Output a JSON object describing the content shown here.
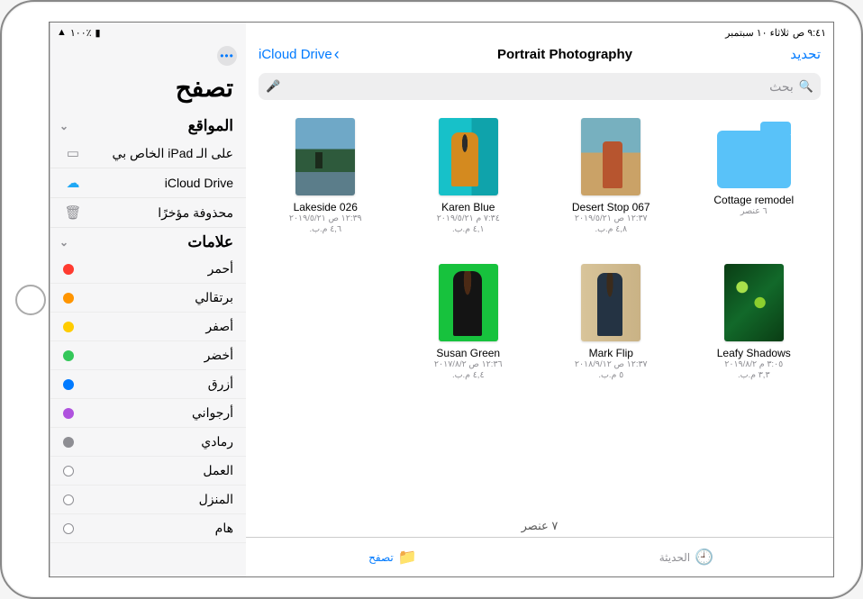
{
  "status": {
    "time": "٩:٤١ ص",
    "date": "ثلاثاء ١٠ سبتمبر",
    "battery": "٪١٠٠"
  },
  "sidebar": {
    "browse": "تصفح",
    "locations_header": "المواقع",
    "locations": [
      {
        "label": "على الـ iPad الخاص بي",
        "icon": "ipad"
      },
      {
        "label": "iCloud Drive",
        "icon": "cloud"
      },
      {
        "label": "محذوفة مؤخرًا",
        "icon": "trash"
      }
    ],
    "tags_header": "علامات",
    "tags": [
      {
        "label": "أحمر",
        "color": "#ff3b30"
      },
      {
        "label": "برتقالي",
        "color": "#ff9500"
      },
      {
        "label": "أصفر",
        "color": "#ffcc00"
      },
      {
        "label": "أخضر",
        "color": "#34c759"
      },
      {
        "label": "أزرق",
        "color": "#007aff"
      },
      {
        "label": "أرجواني",
        "color": "#af52de"
      },
      {
        "label": "رمادي",
        "color": "#8e8e93"
      },
      {
        "label": "العمل",
        "hollow": true
      },
      {
        "label": "المنزل",
        "hollow": true
      },
      {
        "label": "هام",
        "hollow": true
      }
    ]
  },
  "nav": {
    "back": "iCloud Drive",
    "title": "Portrait Photography",
    "select": "تحديد",
    "search_placeholder": "بحث"
  },
  "items": [
    {
      "type": "folder",
      "name": "Cottage remodel",
      "meta1": "٦ عنصر",
      "meta2": ""
    },
    {
      "type": "photo",
      "name": "Desert Stop 067",
      "meta1": "١٢:٣٧ ص ٢٠١٩/٥/٢١",
      "meta2": "٤,٨ م.ب.",
      "thumb": "th-desert"
    },
    {
      "type": "photo",
      "name": "Karen Blue",
      "meta1": "٧:٣٤ م ٢٠١٩/٥/٢١",
      "meta2": "٤,١ م.ب.",
      "thumb": "th-karen"
    },
    {
      "type": "photo",
      "name": "Lakeside 026",
      "meta1": "١٢:٣٩ ص ٢٠١٩/٥/٢١",
      "meta2": "٤,٦ م.ب.",
      "thumb": "th-lake"
    },
    {
      "type": "photo",
      "name": "Leafy Shadows",
      "meta1": "٣:٠٥ م ٢٠١٩/٨/٢",
      "meta2": "٣,٣ م.ب.",
      "thumb": "th-leaf"
    },
    {
      "type": "photo",
      "name": "Mark Flip",
      "meta1": "١٢:٣٧ ص ٢٠١٨/٩/١٢",
      "meta2": "٥ م.ب.",
      "thumb": "th-mark"
    },
    {
      "type": "photo",
      "name": "Susan Green",
      "meta1": "١٢:٣٦ ص ٢٠١٧/٨/٢",
      "meta2": "٤,٤ م.ب.",
      "thumb": "th-susan"
    }
  ],
  "footer": {
    "count": "٧ عنصر"
  },
  "tabs": {
    "recent": "الحديثة",
    "browse": "تصفح"
  }
}
